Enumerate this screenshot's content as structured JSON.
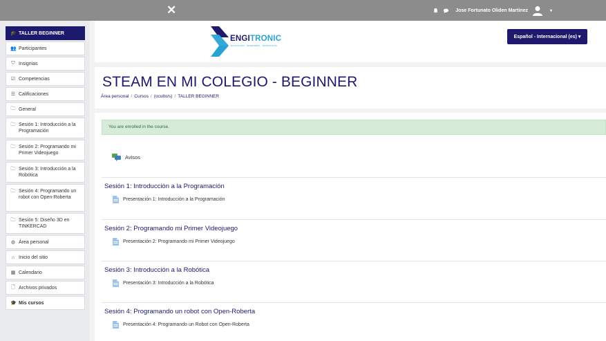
{
  "topbar": {
    "close_glyph": "✕",
    "user_name": "Jose Fortunato Oliden Martinez",
    "caret": "▾",
    "icons": [
      "bell-icon",
      "chat-icon",
      "user-avatar-icon"
    ]
  },
  "sidebar": {
    "items": [
      {
        "label": "TALLER BEGINNER",
        "icon": "mortarboard-icon",
        "glyph": "🎓"
      },
      {
        "label": "Participantes",
        "icon": "users-icon",
        "glyph": "👥"
      },
      {
        "label": "Insignias",
        "icon": "shield-icon",
        "glyph": "⛉"
      },
      {
        "label": "Competencias",
        "icon": "check-square-icon",
        "glyph": "☑"
      },
      {
        "label": "Calificaciones",
        "icon": "table-icon",
        "glyph": "☰"
      },
      {
        "label": "General",
        "icon": "folder-icon",
        "glyph": "🗀"
      },
      {
        "label": "Sesión 1: Introducción a la Programación",
        "icon": "folder-icon",
        "glyph": "🗀"
      },
      {
        "label": "Sesión 2: Programando mi Primer Videojuego",
        "icon": "folder-icon",
        "glyph": "🗀"
      },
      {
        "label": "Sesión 3: Introducción a la Robótica",
        "icon": "folder-icon",
        "glyph": "🗀"
      },
      {
        "label": "Sesión 4: Programando un robot con Open-Roberta",
        "icon": "folder-icon",
        "glyph": "🗀"
      },
      {
        "label": "Sesión 5: Diseño 3D en TINKERCAD",
        "icon": "folder-icon",
        "glyph": "🗀"
      },
      {
        "label": "Área personal",
        "icon": "dashboard-icon",
        "glyph": "◍"
      },
      {
        "label": "Inicio del sitio",
        "icon": "home-icon",
        "glyph": "⌂"
      },
      {
        "label": "Calendario",
        "icon": "calendar-icon",
        "glyph": "▦"
      },
      {
        "label": "Archivos privados",
        "icon": "file-icon",
        "glyph": "🗋"
      },
      {
        "label": "Mis cursos",
        "icon": "mortarboard-icon",
        "glyph": "🎓"
      }
    ]
  },
  "header": {
    "logo": {
      "brand_main": "ENGI",
      "brand_accent": "TRONIC",
      "tagline": "EDUCACIÓN · INGENIERÍA · TECNOLOGÍA"
    },
    "language_label": "Español - Internacional (es) ▾"
  },
  "course": {
    "title": "STEAM EN MI COLEGIO - BEGINNER",
    "breadcrumb": [
      "Área personal",
      "Cursos",
      "(oculto/s)",
      "TALLER BEGINNER"
    ],
    "breadcrumb_sep": "/"
  },
  "content": {
    "alert": "You are enrolled in the course.",
    "avisos_label": "Avisos",
    "sections": [
      {
        "title": "Sesión 1: Introducción a la Programación",
        "resource": "Presentación 1: Introducción a la Programación"
      },
      {
        "title": "Sesión 2: Programando mi Primer Videojuego",
        "resource": "Presentación 2: Programando mi Primer Videojuego"
      },
      {
        "title": "Sesión 3: Introducción a la Robótica",
        "resource": "Presentación 3: Introducción a la Robótica"
      },
      {
        "title": "Sesión 4: Programando un robot con Open-Roberta",
        "resource": "Presentación 4: Programando un Robot con Open-Roberta"
      }
    ]
  },
  "colors": {
    "topbar": "#8c8c8c",
    "brand_navy": "#1d1a6e",
    "brand_blue": "#29a3d4",
    "alert_bg": "#d6ecd9",
    "sidebar_bg": "#e9ebee"
  }
}
